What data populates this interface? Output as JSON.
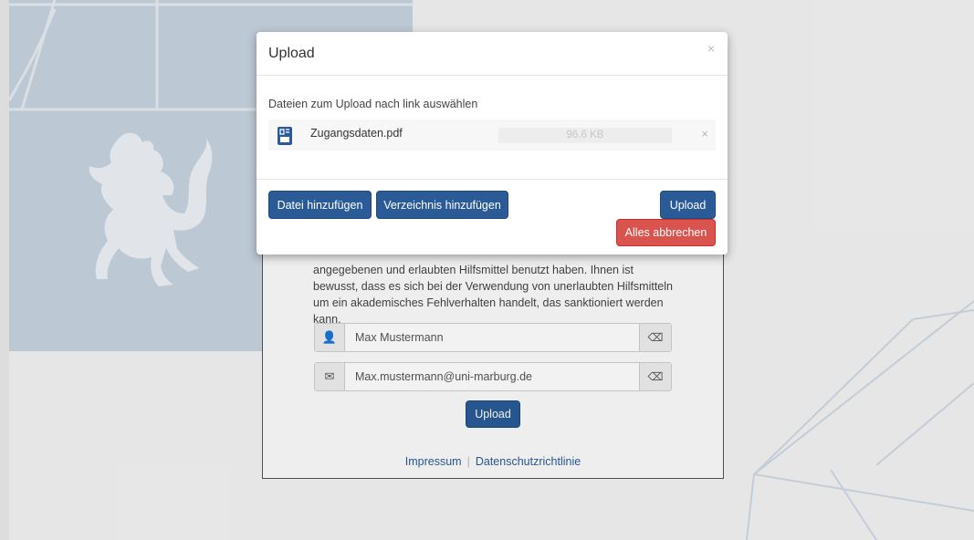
{
  "background": {
    "card_text": "angegebenen und erlaubten Hilfsmittel benutzt haben. Ihnen ist bewusst, dass es sich bei der Verwendung von unerlaubten Hilfsmitteln um ein akademisches Fehlverhalten handelt, das sanktioniert werden kann.",
    "name_field": {
      "value": "Max Mustermann",
      "icon": "user-icon"
    },
    "email_field": {
      "value": "Max.mustermann@uni-marburg.de",
      "icon": "envelope-icon"
    },
    "upload_button": "Upload",
    "footer": {
      "impressum": "Impressum",
      "privacy": "Datenschutzrichtlinie"
    }
  },
  "modal": {
    "title": "Upload",
    "close": "×",
    "prompt": "Dateien zum Upload nach link auswählen",
    "files": [
      {
        "name": "Zugangsdaten.pdf",
        "size": "96.6 KB",
        "progress": 0,
        "icon": "pdf-file-icon",
        "remove": "×"
      }
    ],
    "buttons": {
      "add_file": "Datei hinzufügen",
      "add_directory": "Verzeichnis hinzufügen",
      "upload": "Upload",
      "cancel_all": "Alles abbrechen"
    }
  },
  "colors": {
    "primary": "#2a5b96",
    "danger": "#d9534f",
    "hero": "#c7d3e0"
  }
}
